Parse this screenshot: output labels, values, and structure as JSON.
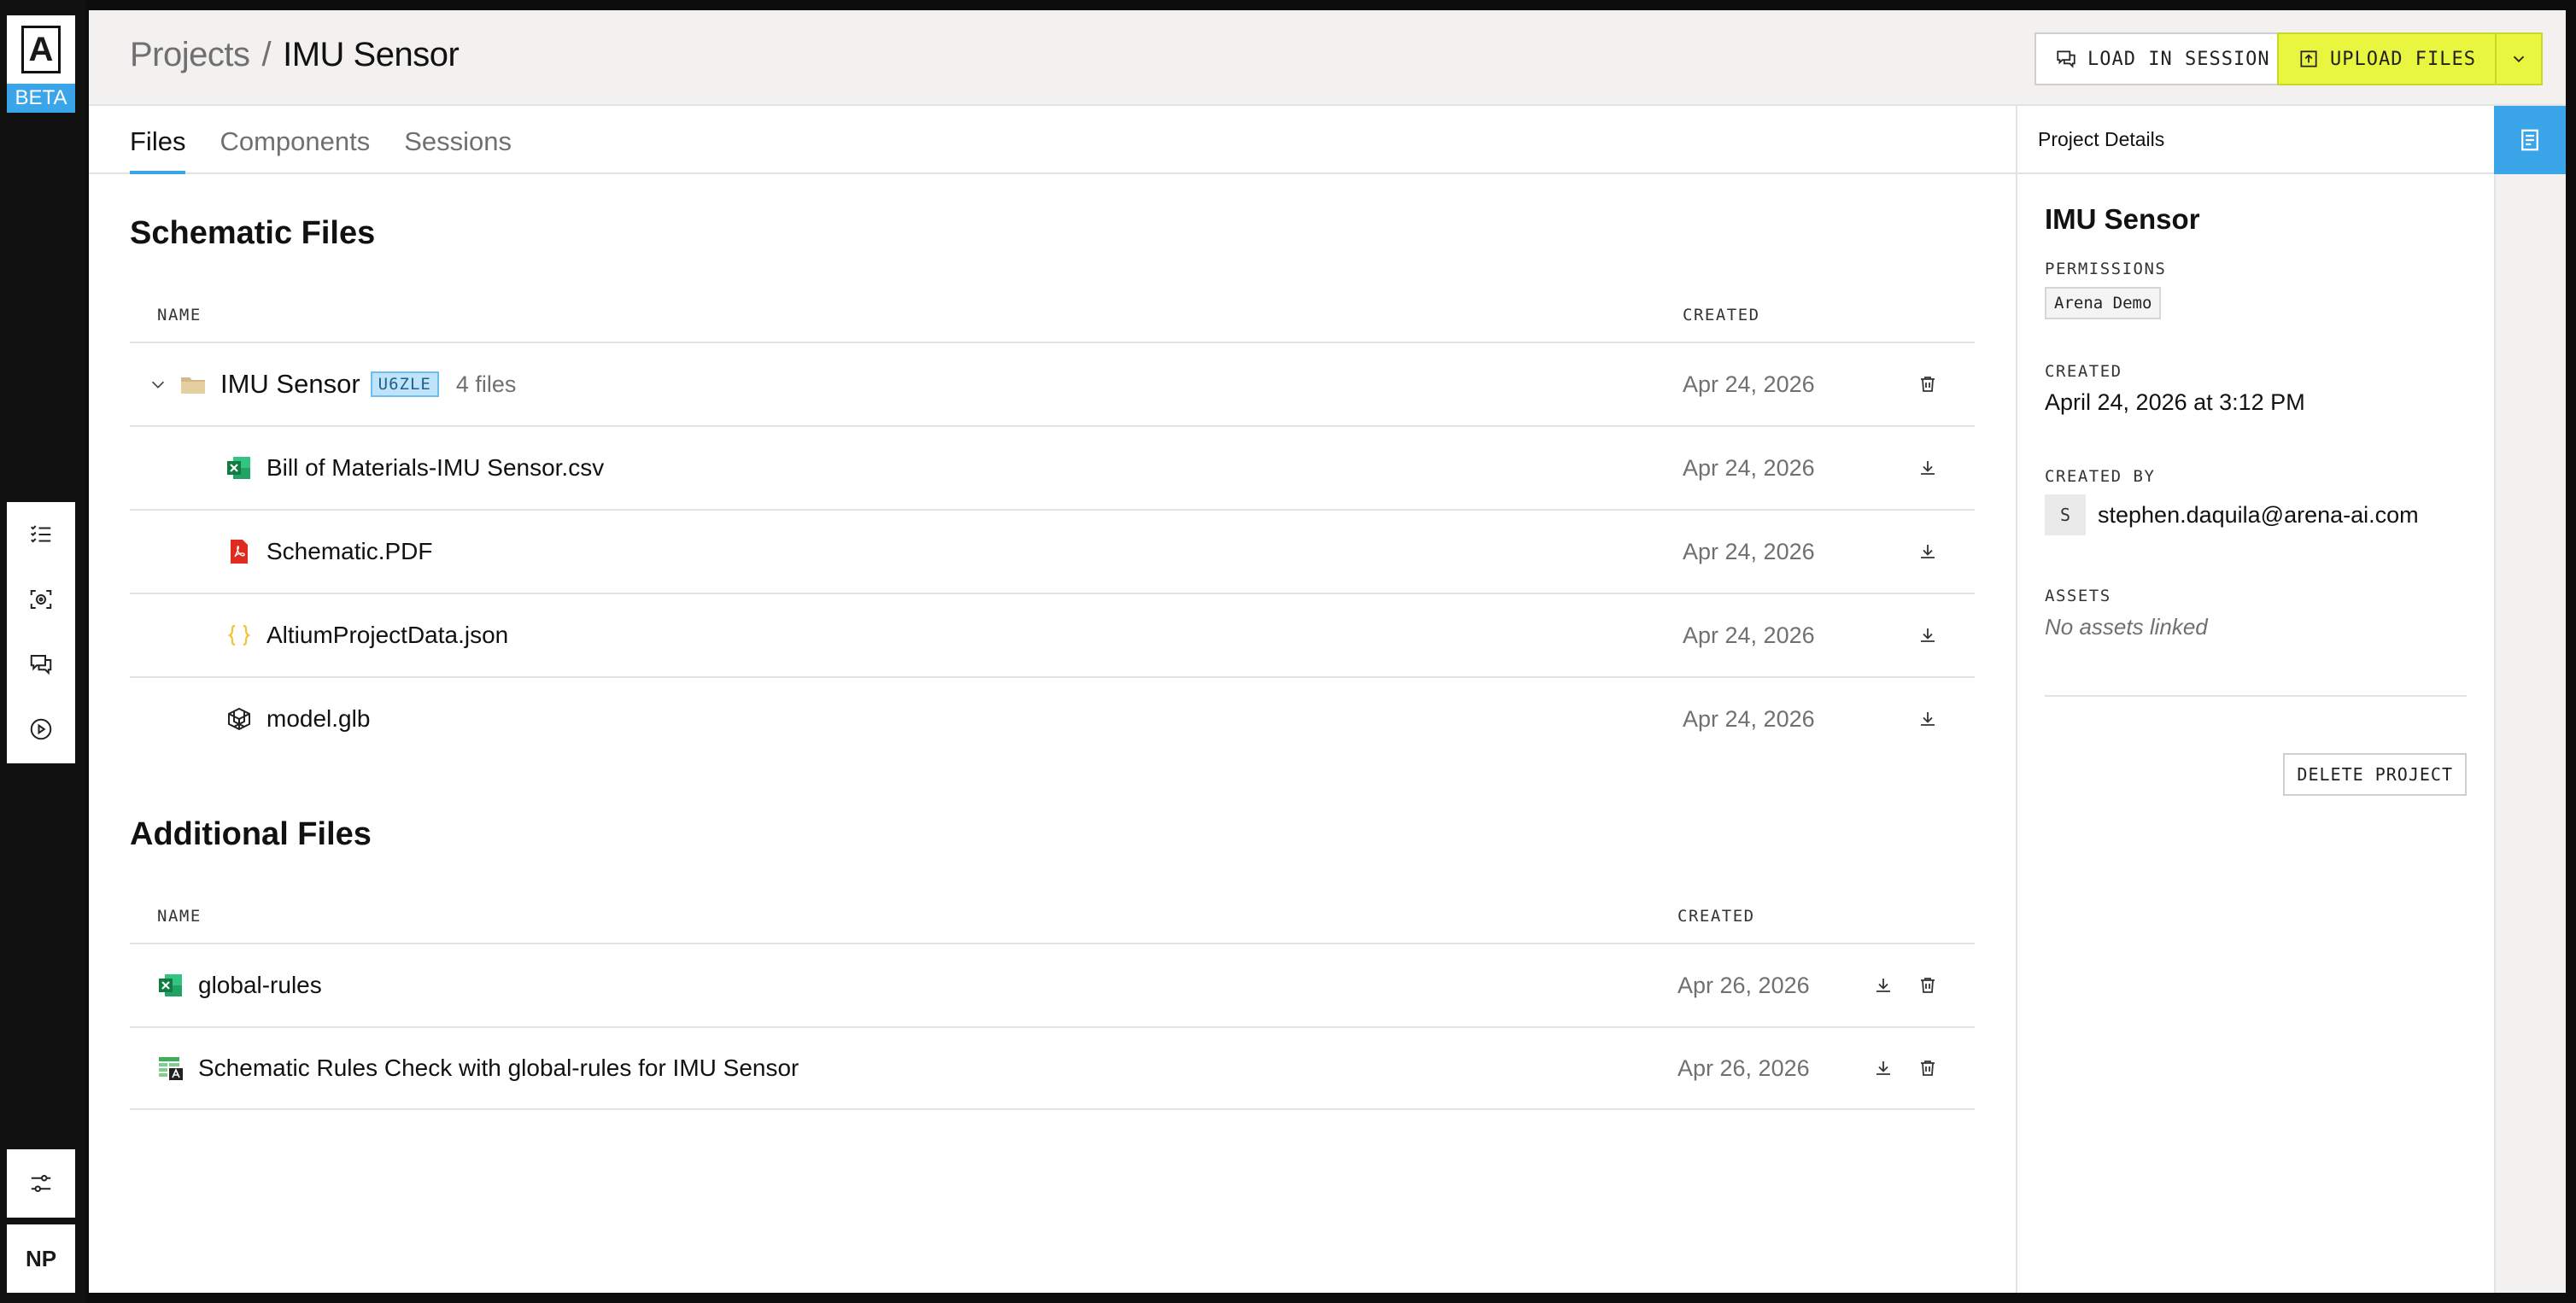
{
  "brand": {
    "logo_text": "A",
    "beta_label": "BETA"
  },
  "nav": {
    "icons": [
      "checklist-icon",
      "scan-icon",
      "chat-icon",
      "play-icon"
    ],
    "settings_icon": "sliders-icon",
    "user_initials": "NP"
  },
  "header": {
    "breadcrumb_root": "Projects",
    "breadcrumb_sep": "/",
    "breadcrumb_current": "IMU Sensor",
    "load_session_label": "LOAD IN SESSION",
    "upload_label": "UPLOAD FILES"
  },
  "tabs": [
    {
      "label": "Files",
      "active": true
    },
    {
      "label": "Components",
      "active": false
    },
    {
      "label": "Sessions",
      "active": false
    }
  ],
  "schematic": {
    "title": "Schematic Files",
    "col_name": "NAME",
    "col_created": "CREATED",
    "folder": {
      "name": "IMU Sensor",
      "badge": "U6ZLE",
      "count": "4 files",
      "created": "Apr 24, 2026"
    },
    "files": [
      {
        "name": "Bill of Materials-IMU Sensor.csv",
        "created": "Apr 24, 2026",
        "icon": "excel-icon"
      },
      {
        "name": "Schematic.PDF",
        "created": "Apr 24, 2026",
        "icon": "pdf-icon"
      },
      {
        "name": "AltiumProjectData.json",
        "created": "Apr 24, 2026",
        "icon": "json-icon"
      },
      {
        "name": "model.glb",
        "created": "Apr 24, 2026",
        "icon": "cube-icon"
      }
    ]
  },
  "additional": {
    "title": "Additional Files",
    "col_name": "NAME",
    "col_created": "CREATED",
    "files": [
      {
        "name": "global-rules",
        "created": "Apr 26, 2026",
        "icon": "excel-icon"
      },
      {
        "name": "Schematic Rules Check with global-rules for IMU Sensor",
        "created": "Apr 26, 2026",
        "icon": "rules-sheet-icon"
      }
    ]
  },
  "details": {
    "panel_title": "Project Details",
    "project_name": "IMU Sensor",
    "permissions_label": "PERMISSIONS",
    "permission": "Arena Demo",
    "created_label": "CREATED",
    "created_value": "April 24, 2026 at 3:12 PM",
    "created_by_label": "CREATED BY",
    "creator_initial": "S",
    "creator_email": "stephen.daquila@arena-ai.com",
    "assets_label": "ASSETS",
    "assets_empty": "No assets linked",
    "delete_label": "DELETE PROJECT"
  },
  "colors": {
    "accent": "#3aa5e9",
    "upload": "#e9f63f",
    "badge": "#bfe3fb"
  }
}
